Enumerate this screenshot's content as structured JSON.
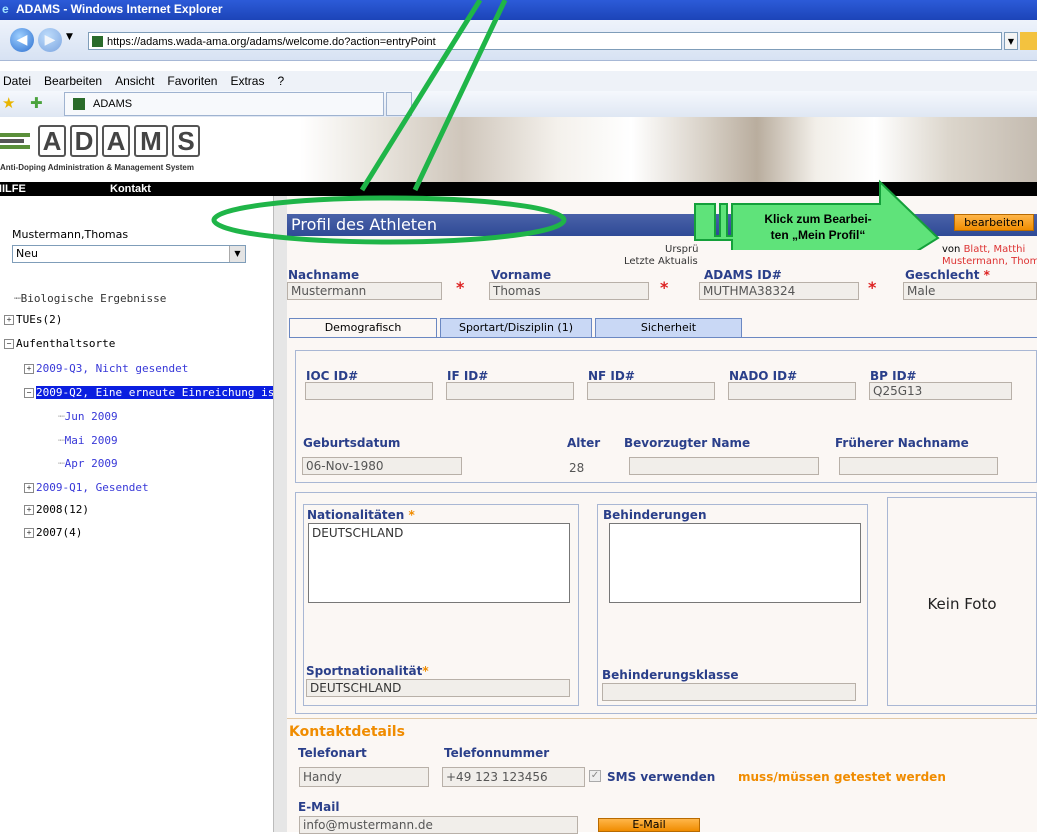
{
  "browser": {
    "title": "ADAMS - Windows Internet Explorer",
    "url": "https://adams.wada-ama.org/adams/welcome.do?action=entryPoint",
    "menu": [
      "Datei",
      "Bearbeiten",
      "Ansicht",
      "Favoriten",
      "Extras",
      "?"
    ],
    "tab_label": "ADAMS"
  },
  "header": {
    "logo_letters": [
      "A",
      "D",
      "A",
      "M",
      "S"
    ],
    "logo_subtitle": "Anti-Doping Administration & Management System",
    "nav": [
      "HILFE",
      "Kontakt"
    ]
  },
  "sidebar": {
    "user": "Mustermann,Thomas",
    "role_select": "Neu",
    "tree": {
      "bio": "Biologische Ergebnisse",
      "tues": "TUEs(2)",
      "whereabouts": "Aufenthaltsorte",
      "q3": "2009-Q3, Nicht gesendet",
      "q2": "2009-Q2, Eine erneute Einreichung is",
      "jun": "Jun 2009",
      "mai": "Mai 2009",
      "apr": "Apr 2009",
      "q1": "2009-Q1, Gesendet",
      "y2008": "2008(12)",
      "y2007": "2007(4)"
    }
  },
  "profile": {
    "title": "Profil des Athleten",
    "edit_button": "bearbeiten",
    "meta_origin_fragment": "Ursprü",
    "meta_updated_fragment": "Letzte Aktualis",
    "meta_by_prefix": "von ",
    "meta_by_name": "Blatt, Matthi",
    "meta_updated_by": "Mustermann, Thom",
    "labels": {
      "lastname": "Nachname",
      "firstname": "Vorname",
      "adams_id": "ADAMS ID#",
      "gender": "Geschlecht"
    },
    "values": {
      "lastname": "Mustermann",
      "firstname": "Thomas",
      "adams_id": "MUTHMA38324",
      "gender": "Male"
    },
    "required_marker": "*",
    "tabs": [
      "Demografisch",
      "Sportart/Disziplin (1)",
      "Sicherheit"
    ],
    "ids": {
      "ioc_label": "IOC ID#",
      "if_label": "IF ID#",
      "nf_label": "NF ID#",
      "nado_label": "NADO ID#",
      "bp_label": "BP ID#",
      "bp_value": "Q25G13"
    },
    "birth": {
      "dob_label": "Geburtsdatum",
      "dob_value": "06-Nov-1980",
      "age_label": "Alter",
      "age_value": "28",
      "pref_name_label": "Bevorzugter Name",
      "former_name_label": "Früherer Nachname"
    },
    "nationalities_label": "Nationalitäten",
    "nationalities_value": "DEUTSCHLAND",
    "disabilities_label": "Behinderungen",
    "photo_placeholder": "Kein Foto",
    "sport_nationality_label": "Sportnationalität",
    "sport_nationality_value": "DEUTSCHLAND",
    "disability_class_label": "Behinderungsklasse"
  },
  "contact": {
    "heading": "Kontaktdetails",
    "phone_type_label": "Telefonart",
    "phone_number_label": "Telefonnummer",
    "phone_type_value": "Handy",
    "phone_number_value": "+49 123 123456",
    "sms_label": "SMS verwenden",
    "test_warning": "muss/müssen getestet werden",
    "email_label": "E-Mail",
    "email_value": "info@mustermann.de",
    "email_button": "E-Mail"
  },
  "annotation": {
    "callout": "Klick zum Bearbei-\nten „Mein Profil“"
  },
  "colors": {
    "ie_title": "#1c44b8",
    "section_title": "#3a55a0",
    "label_blue": "#2a3f8a",
    "link_blue": "#3838d8",
    "orange": "#f08c00",
    "annotation_green": "#1fb548"
  }
}
